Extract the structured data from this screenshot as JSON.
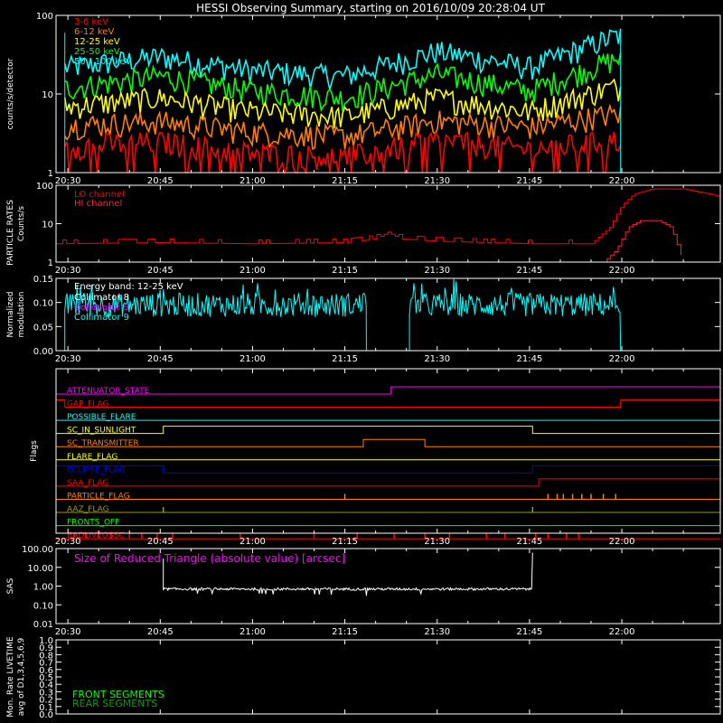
{
  "title": "HESSI Observing Summary, starting on 2016/10/09 20:28:04 UT",
  "time_ticks": [
    "20:30",
    "20:45",
    "21:00",
    "21:15",
    "21:30",
    "21:45",
    "22:00"
  ],
  "time_tick_values": [
    30,
    45,
    60,
    75,
    90,
    105,
    120
  ],
  "time_range": [
    28.07,
    136.0
  ],
  "colors": {
    "red": "#ff0000",
    "orange": "#ff7f00",
    "yellow": "#ffff00",
    "green": "#00ff00",
    "cyan": "#00ffff",
    "magenta": "#ff00ff",
    "blue": "#0000ff",
    "olive": "#9c9c00",
    "white": "#ffffff",
    "dkgreen": "#00a000",
    "crimson": "#ff2040"
  },
  "chart_data": [
    {
      "id": "count-rates",
      "type": "line",
      "ylabel": "counts/s/detector",
      "yscale": "log",
      "ylim": [
        1,
        100
      ],
      "y_ticks": [
        "1",
        "10",
        "100"
      ],
      "y_tick_values": [
        1,
        10,
        100
      ],
      "legend": "top-left",
      "series": [
        {
          "name": "3-6 keV",
          "color": "red",
          "base": [
            [
              30,
              2.2
            ],
            [
              45,
              2.5
            ],
            [
              60,
              1.8
            ],
            [
              75,
              1.6
            ],
            [
              90,
              2.6
            ],
            [
              105,
              2.0
            ],
            [
              119,
              2.6
            ]
          ]
        },
        {
          "name": "6-12 keV",
          "color": "orange",
          "base": [
            [
              30,
              4
            ],
            [
              45,
              4.5
            ],
            [
              60,
              3.3
            ],
            [
              75,
              2.9
            ],
            [
              90,
              4.6
            ],
            [
              105,
              3.8
            ],
            [
              118,
              5.5
            ]
          ]
        },
        {
          "name": "12-25 keV",
          "color": "yellow",
          "base": [
            [
              30,
              7
            ],
            [
              45,
              9
            ],
            [
              60,
              6
            ],
            [
              75,
              5.2
            ],
            [
              90,
              9
            ],
            [
              105,
              6
            ],
            [
              118,
              12
            ]
          ]
        },
        {
          "name": "25-50 keV",
          "color": "green",
          "base": [
            [
              30,
              12
            ],
            [
              45,
              17
            ],
            [
              60,
              11
            ],
            [
              75,
              9
            ],
            [
              90,
              18
            ],
            [
              105,
              11
            ],
            [
              119,
              28
            ]
          ]
        },
        {
          "name": "50 - 100 keV",
          "color": "cyan",
          "base": [
            [
              30,
              22
            ],
            [
              45,
              30
            ],
            [
              60,
              20
            ],
            [
              75,
              17
            ],
            [
              90,
              35
            ],
            [
              105,
              22
            ],
            [
              119,
              55
            ]
          ]
        }
      ],
      "data_range": [
        29.5,
        119.8
      ]
    },
    {
      "id": "particle-rates",
      "type": "line",
      "ylabel": "PARTICLE RATES Counts/s",
      "yscale": "log",
      "ylim": [
        1,
        100
      ],
      "y_ticks": [
        "1",
        "10",
        "100"
      ],
      "y_tick_values": [
        1,
        10,
        100
      ],
      "legend": "top-left",
      "series": [
        {
          "name": "LO channel",
          "color": "red",
          "points": [
            [
              28,
              3
            ],
            [
              45,
              3.2
            ],
            [
              60,
              3
            ],
            [
              75,
              3.2
            ],
            [
              80,
              4
            ],
            [
              82,
              6
            ],
            [
              84,
              4
            ],
            [
              90,
              3.5
            ],
            [
              105,
              3
            ],
            [
              115,
              3
            ],
            [
              118,
              8
            ],
            [
              120,
              30
            ],
            [
              122,
              60
            ],
            [
              125,
              80
            ],
            [
              130,
              80
            ],
            [
              134,
              60
            ],
            [
              136,
              50
            ]
          ]
        },
        {
          "name": "HI channel",
          "color": "crimson",
          "points": [
            [
              117,
              1
            ],
            [
              119,
              2
            ],
            [
              121,
              8
            ],
            [
              123,
              12
            ],
            [
              126,
              12
            ],
            [
              128,
              8
            ],
            [
              130,
              1
            ]
          ]
        }
      ]
    },
    {
      "id": "modulation",
      "type": "line",
      "ylabel": "Normalized modulation",
      "ylim": [
        0,
        0.15
      ],
      "y_ticks": [
        "0.00",
        "0.05",
        "0.10",
        "0.15"
      ],
      "y_tick_values": [
        0,
        0.05,
        0.1,
        0.15
      ],
      "legend": "top-left",
      "annotation": "Energy band: 12-25 keV",
      "series": [
        {
          "name": "Collimator 8",
          "color": "white",
          "segments": []
        },
        {
          "name": "Collimator 9",
          "color": "magenta",
          "segments": []
        },
        {
          "name": "Collimator 9",
          "color": "cyan",
          "level": 0.095,
          "segments": [
            [
              29.5,
              78.5
            ],
            [
              85.5,
              119.8
            ]
          ]
        }
      ]
    },
    {
      "id": "flags",
      "type": "line",
      "ylabel": "Flags",
      "legend": "inline",
      "series": [
        {
          "name": "ATTENUATOR_STATE",
          "color": "magenta",
          "steps": [
            [
              28,
              0
            ],
            [
              82.5,
              1
            ]
          ]
        },
        {
          "name": "GAP_FLAG",
          "color": "red",
          "steps": [
            [
              28,
              1
            ],
            [
              29.5,
              0
            ],
            [
              119.8,
              1
            ]
          ]
        },
        {
          "name": "POSSIBLE_FLARE",
          "color": "cyan",
          "steps": [
            [
              28,
              0
            ]
          ]
        },
        {
          "name": "SC_IN_SUNLIGHT",
          "color": "yellow",
          "steps": [
            [
              28,
              0
            ],
            [
              45.5,
              1
            ],
            [
              105.5,
              0
            ]
          ]
        },
        {
          "name": "SC_TRANSMITTER",
          "color": "orange",
          "steps": [
            [
              28,
              0
            ],
            [
              78,
              1
            ],
            [
              88,
              0
            ]
          ]
        },
        {
          "name": "FLARE_FLAG",
          "color": "yellow",
          "steps": [
            [
              28,
              0
            ]
          ]
        },
        {
          "name": "ECLIPSE_FLAG",
          "color": "blue",
          "steps": [
            [
              28,
              1
            ],
            [
              45.5,
              0
            ],
            [
              105.5,
              1
            ]
          ]
        },
        {
          "name": "SAA_FLAG",
          "color": "red",
          "steps": [
            [
              28,
              0
            ],
            [
              106.5,
              1
            ]
          ]
        },
        {
          "name": "PARTICLE_FLAG",
          "color": "orange",
          "steps": [
            [
              28,
              0
            ]
          ]
        },
        {
          "name": "AAZ_FLAG",
          "color": "olive",
          "steps": [
            [
              28,
              0
            ]
          ]
        },
        {
          "name": "FRONTS_OFF",
          "color": "green",
          "steps": [
            [
              28,
              0
            ]
          ]
        },
        {
          "name": "BADLIVEOSSC",
          "color": "red",
          "steps": [
            [
              28,
              0
            ]
          ]
        }
      ]
    },
    {
      "id": "sas",
      "type": "line",
      "ylabel": "SAS",
      "yscale": "log",
      "ylim": [
        0.01,
        100
      ],
      "y_ticks": [
        "0.01",
        "0.10",
        "1.00",
        "10.00",
        "100.00"
      ],
      "y_tick_values": [
        0.01,
        0.1,
        1,
        10,
        100
      ],
      "annotation": "Size of Reduced Triangle (absolute value) [arcsec]",
      "series": [
        {
          "name": "",
          "color": "white",
          "level": 0.7,
          "range": [
            45.5,
            105.5
          ]
        }
      ]
    },
    {
      "id": "livetime",
      "type": "line",
      "ylabel": "Mon. Rate LIVETIME avg of D1,3,4,5,6,9",
      "ylim": [
        0,
        1.0
      ],
      "y_ticks": [
        "0.0",
        "0.1",
        "0.2",
        "0.3",
        "0.4",
        "0.5",
        "0.6",
        "0.7",
        "0.8",
        "0.9",
        "1.0"
      ],
      "y_tick_values": [
        0,
        0.1,
        0.2,
        0.3,
        0.4,
        0.5,
        0.6,
        0.7,
        0.8,
        0.9,
        1.0
      ],
      "legend": "bottom-left",
      "series": [
        {
          "name": "FRONT SEGMENTS",
          "color": "green"
        },
        {
          "name": "REAR SEGMENTS",
          "color": "dkgreen"
        }
      ]
    }
  ]
}
